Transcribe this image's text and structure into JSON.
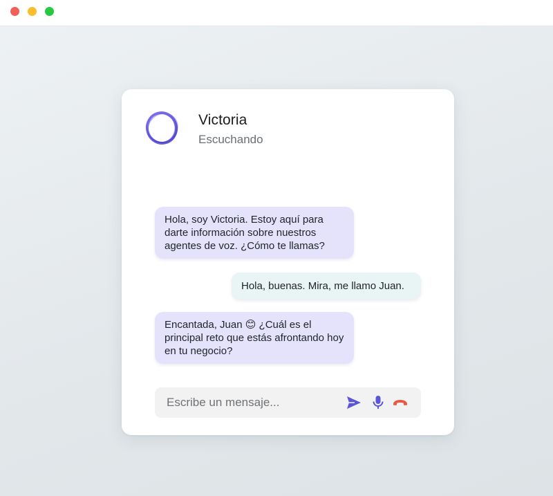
{
  "window": {
    "controls": [
      "close",
      "minimize",
      "maximize"
    ]
  },
  "agent": {
    "name": "Victoria",
    "status": "Escuchando",
    "avatar_icon": "ring-logo-icon"
  },
  "messages": [
    {
      "sender": "agent",
      "text": "Hola, soy Victoria. Estoy aquí para darte información sobre nuestros agentes de voz. ¿Cómo te llamas?"
    },
    {
      "sender": "user",
      "text": "Hola, buenas. Mira, me llamo Juan."
    },
    {
      "sender": "agent",
      "text": "Encantada, Juan 😊 ¿Cuál es el principal reto que estás afrontando hoy en tu negocio?"
    }
  ],
  "composer": {
    "placeholder": "Escribe un mensaje...",
    "value": "",
    "icons": [
      "send-icon",
      "microphone-icon",
      "hang-up-icon"
    ]
  },
  "colors": {
    "accent": "#5b56d6",
    "agent_bubble": "#e5e3fb",
    "user_bubble": "#e9f4f4",
    "hang_up": "#e65a45"
  }
}
